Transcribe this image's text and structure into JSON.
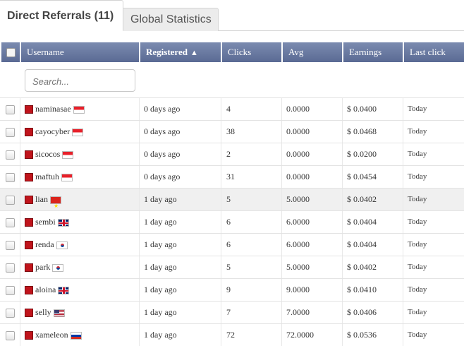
{
  "tabs": {
    "active": "Direct Referrals (11)",
    "inactive": "Global Statistics"
  },
  "table": {
    "headers": {
      "username": "Username",
      "registered": "Registered",
      "clicks": "Clicks",
      "avg": "Avg",
      "earnings": "Earnings",
      "last_click": "Last click"
    },
    "search_placeholder": "Search...",
    "rows": [
      {
        "username": "naminasae",
        "flag": "indonesia",
        "registered": "0 days ago",
        "clicks": "4",
        "avg": "0.0000",
        "earnings": "$ 0.0400",
        "last_click": "Today"
      },
      {
        "username": "cayocyber",
        "flag": "indonesia",
        "registered": "0 days ago",
        "clicks": "38",
        "avg": "0.0000",
        "earnings": "$ 0.0468",
        "last_click": "Today"
      },
      {
        "username": "sicocos",
        "flag": "indonesia",
        "registered": "0 days ago",
        "clicks": "2",
        "avg": "0.0000",
        "earnings": "$ 0.0200",
        "last_click": "Today"
      },
      {
        "username": "maftuh",
        "flag": "indonesia",
        "registered": "0 days ago",
        "clicks": "31",
        "avg": "0.0000",
        "earnings": "$ 0.0454",
        "last_click": "Today"
      },
      {
        "username": "lian",
        "flag": "vietnam",
        "registered": "1 day ago",
        "clicks": "5",
        "avg": "5.0000",
        "earnings": "$ 0.0402",
        "last_click": "Today"
      },
      {
        "username": "sembi",
        "flag": "united-kingdom",
        "registered": "1 day ago",
        "clicks": "6",
        "avg": "6.0000",
        "earnings": "$ 0.0404",
        "last_click": "Today"
      },
      {
        "username": "renda",
        "flag": "south-korea",
        "registered": "1 day ago",
        "clicks": "6",
        "avg": "6.0000",
        "earnings": "$ 0.0404",
        "last_click": "Today"
      },
      {
        "username": "park",
        "flag": "south-korea",
        "registered": "1 day ago",
        "clicks": "5",
        "avg": "5.0000",
        "earnings": "$ 0.0402",
        "last_click": "Today"
      },
      {
        "username": "aloina",
        "flag": "united-kingdom",
        "registered": "1 day ago",
        "clicks": "9",
        "avg": "9.0000",
        "earnings": "$ 0.0410",
        "last_click": "Today"
      },
      {
        "username": "selly",
        "flag": "united-states",
        "registered": "1 day ago",
        "clicks": "7",
        "avg": "7.0000",
        "earnings": "$ 0.0406",
        "last_click": "Today"
      },
      {
        "username": "xameleon",
        "flag": "russia",
        "registered": "1 day ago",
        "clicks": "72",
        "avg": "72.0000",
        "earnings": "$ 0.0536",
        "last_click": "Today"
      }
    ]
  },
  "colors": {
    "header_bg": "#6a7aa2",
    "user_icon": "#c0141c",
    "row_highlight": "#f0f0f0"
  }
}
